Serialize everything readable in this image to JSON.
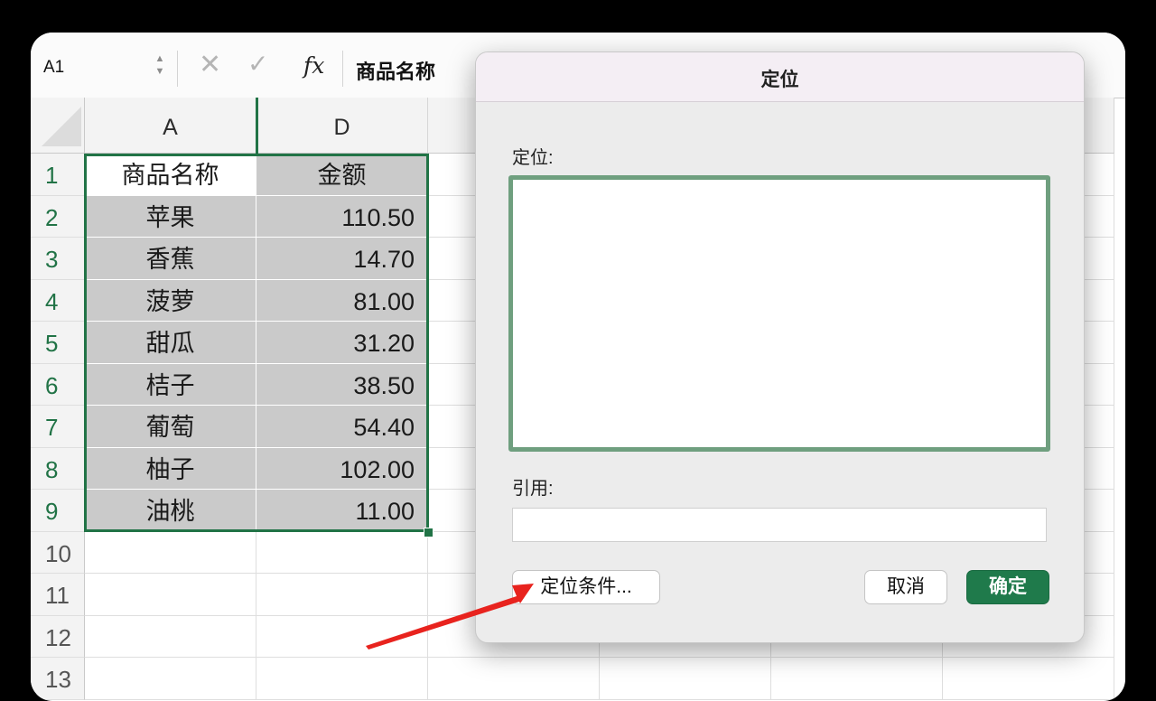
{
  "formula_bar": {
    "name_box": "A1",
    "stepper_up": "▲",
    "stepper_down": "▼",
    "cancel_glyph": "✕",
    "confirm_glyph": "✓",
    "fx_label": "fx",
    "value": "商品名称"
  },
  "sheet": {
    "columns": [
      "A",
      "D"
    ],
    "row_numbers": [
      "1",
      "2",
      "3",
      "4",
      "5",
      "6",
      "7",
      "8",
      "9",
      "10",
      "11",
      "12",
      "13"
    ],
    "header_row": {
      "name": "商品名称",
      "amount": "金额"
    },
    "rows": [
      {
        "name": "苹果",
        "amount": "110.50"
      },
      {
        "name": "香蕉",
        "amount": "14.70"
      },
      {
        "name": "菠萝",
        "amount": "81.00"
      },
      {
        "name": "甜瓜",
        "amount": "31.20"
      },
      {
        "name": "桔子",
        "amount": "38.50"
      },
      {
        "name": "葡萄",
        "amount": "54.40"
      },
      {
        "name": "柚子",
        "amount": "102.00"
      },
      {
        "name": "油桃",
        "amount": "11.00"
      }
    ],
    "selection_color": "#217346"
  },
  "dialog": {
    "title": "定位",
    "goto_label": "定位:",
    "reference_label": "引用:",
    "reference_value": "",
    "special_button": "定位条件...",
    "cancel_button": "取消",
    "ok_button": "确定",
    "accent_color": "#1f7a4b"
  },
  "annotation": {
    "arrow_color": "#e8231e"
  }
}
